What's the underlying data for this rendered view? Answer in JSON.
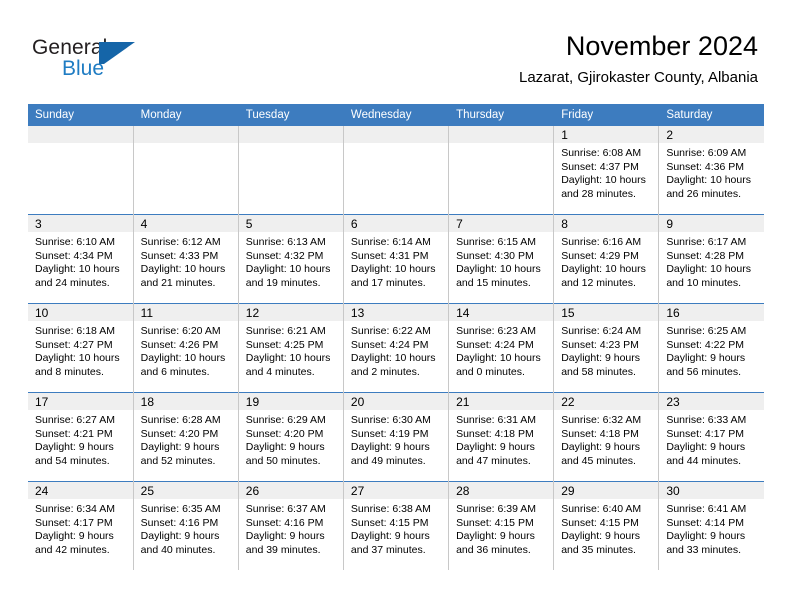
{
  "brand": {
    "name_top": "General",
    "name_bottom": "Blue",
    "mark": "flag-triangle-icon",
    "accent_color": "#1565a8",
    "text_color": "#231f20"
  },
  "header": {
    "title": "November 2024",
    "subtitle": "Lazarat, Gjirokaster County, Albania"
  },
  "theme": {
    "header_blue": "#3d7cbf",
    "daynum_band": "#efefef",
    "grid_line": "#c8c8c8",
    "row_rule": "#3d7cbf"
  },
  "weekday_headers": [
    "Sunday",
    "Monday",
    "Tuesday",
    "Wednesday",
    "Thursday",
    "Friday",
    "Saturday"
  ],
  "weeks": [
    [
      {
        "day": "",
        "empty": true
      },
      {
        "day": "",
        "empty": true
      },
      {
        "day": "",
        "empty": true
      },
      {
        "day": "",
        "empty": true
      },
      {
        "day": "",
        "empty": true
      },
      {
        "day": "1",
        "sunrise": "Sunrise: 6:08 AM",
        "sunset": "Sunset: 4:37 PM",
        "daylight_1": "Daylight: 10 hours",
        "daylight_2": "and 28 minutes."
      },
      {
        "day": "2",
        "sunrise": "Sunrise: 6:09 AM",
        "sunset": "Sunset: 4:36 PM",
        "daylight_1": "Daylight: 10 hours",
        "daylight_2": "and 26 minutes."
      }
    ],
    [
      {
        "day": "3",
        "sunrise": "Sunrise: 6:10 AM",
        "sunset": "Sunset: 4:34 PM",
        "daylight_1": "Daylight: 10 hours",
        "daylight_2": "and 24 minutes."
      },
      {
        "day": "4",
        "sunrise": "Sunrise: 6:12 AM",
        "sunset": "Sunset: 4:33 PM",
        "daylight_1": "Daylight: 10 hours",
        "daylight_2": "and 21 minutes."
      },
      {
        "day": "5",
        "sunrise": "Sunrise: 6:13 AM",
        "sunset": "Sunset: 4:32 PM",
        "daylight_1": "Daylight: 10 hours",
        "daylight_2": "and 19 minutes."
      },
      {
        "day": "6",
        "sunrise": "Sunrise: 6:14 AM",
        "sunset": "Sunset: 4:31 PM",
        "daylight_1": "Daylight: 10 hours",
        "daylight_2": "and 17 minutes."
      },
      {
        "day": "7",
        "sunrise": "Sunrise: 6:15 AM",
        "sunset": "Sunset: 4:30 PM",
        "daylight_1": "Daylight: 10 hours",
        "daylight_2": "and 15 minutes."
      },
      {
        "day": "8",
        "sunrise": "Sunrise: 6:16 AM",
        "sunset": "Sunset: 4:29 PM",
        "daylight_1": "Daylight: 10 hours",
        "daylight_2": "and 12 minutes."
      },
      {
        "day": "9",
        "sunrise": "Sunrise: 6:17 AM",
        "sunset": "Sunset: 4:28 PM",
        "daylight_1": "Daylight: 10 hours",
        "daylight_2": "and 10 minutes."
      }
    ],
    [
      {
        "day": "10",
        "sunrise": "Sunrise: 6:18 AM",
        "sunset": "Sunset: 4:27 PM",
        "daylight_1": "Daylight: 10 hours",
        "daylight_2": "and 8 minutes."
      },
      {
        "day": "11",
        "sunrise": "Sunrise: 6:20 AM",
        "sunset": "Sunset: 4:26 PM",
        "daylight_1": "Daylight: 10 hours",
        "daylight_2": "and 6 minutes."
      },
      {
        "day": "12",
        "sunrise": "Sunrise: 6:21 AM",
        "sunset": "Sunset: 4:25 PM",
        "daylight_1": "Daylight: 10 hours",
        "daylight_2": "and 4 minutes."
      },
      {
        "day": "13",
        "sunrise": "Sunrise: 6:22 AM",
        "sunset": "Sunset: 4:24 PM",
        "daylight_1": "Daylight: 10 hours",
        "daylight_2": "and 2 minutes."
      },
      {
        "day": "14",
        "sunrise": "Sunrise: 6:23 AM",
        "sunset": "Sunset: 4:24 PM",
        "daylight_1": "Daylight: 10 hours",
        "daylight_2": "and 0 minutes."
      },
      {
        "day": "15",
        "sunrise": "Sunrise: 6:24 AM",
        "sunset": "Sunset: 4:23 PM",
        "daylight_1": "Daylight: 9 hours",
        "daylight_2": "and 58 minutes."
      },
      {
        "day": "16",
        "sunrise": "Sunrise: 6:25 AM",
        "sunset": "Sunset: 4:22 PM",
        "daylight_1": "Daylight: 9 hours",
        "daylight_2": "and 56 minutes."
      }
    ],
    [
      {
        "day": "17",
        "sunrise": "Sunrise: 6:27 AM",
        "sunset": "Sunset: 4:21 PM",
        "daylight_1": "Daylight: 9 hours",
        "daylight_2": "and 54 minutes."
      },
      {
        "day": "18",
        "sunrise": "Sunrise: 6:28 AM",
        "sunset": "Sunset: 4:20 PM",
        "daylight_1": "Daylight: 9 hours",
        "daylight_2": "and 52 minutes."
      },
      {
        "day": "19",
        "sunrise": "Sunrise: 6:29 AM",
        "sunset": "Sunset: 4:20 PM",
        "daylight_1": "Daylight: 9 hours",
        "daylight_2": "and 50 minutes."
      },
      {
        "day": "20",
        "sunrise": "Sunrise: 6:30 AM",
        "sunset": "Sunset: 4:19 PM",
        "daylight_1": "Daylight: 9 hours",
        "daylight_2": "and 49 minutes."
      },
      {
        "day": "21",
        "sunrise": "Sunrise: 6:31 AM",
        "sunset": "Sunset: 4:18 PM",
        "daylight_1": "Daylight: 9 hours",
        "daylight_2": "and 47 minutes."
      },
      {
        "day": "22",
        "sunrise": "Sunrise: 6:32 AM",
        "sunset": "Sunset: 4:18 PM",
        "daylight_1": "Daylight: 9 hours",
        "daylight_2": "and 45 minutes."
      },
      {
        "day": "23",
        "sunrise": "Sunrise: 6:33 AM",
        "sunset": "Sunset: 4:17 PM",
        "daylight_1": "Daylight: 9 hours",
        "daylight_2": "and 44 minutes."
      }
    ],
    [
      {
        "day": "24",
        "sunrise": "Sunrise: 6:34 AM",
        "sunset": "Sunset: 4:17 PM",
        "daylight_1": "Daylight: 9 hours",
        "daylight_2": "and 42 minutes."
      },
      {
        "day": "25",
        "sunrise": "Sunrise: 6:35 AM",
        "sunset": "Sunset: 4:16 PM",
        "daylight_1": "Daylight: 9 hours",
        "daylight_2": "and 40 minutes."
      },
      {
        "day": "26",
        "sunrise": "Sunrise: 6:37 AM",
        "sunset": "Sunset: 4:16 PM",
        "daylight_1": "Daylight: 9 hours",
        "daylight_2": "and 39 minutes."
      },
      {
        "day": "27",
        "sunrise": "Sunrise: 6:38 AM",
        "sunset": "Sunset: 4:15 PM",
        "daylight_1": "Daylight: 9 hours",
        "daylight_2": "and 37 minutes."
      },
      {
        "day": "28",
        "sunrise": "Sunrise: 6:39 AM",
        "sunset": "Sunset: 4:15 PM",
        "daylight_1": "Daylight: 9 hours",
        "daylight_2": "and 36 minutes."
      },
      {
        "day": "29",
        "sunrise": "Sunrise: 6:40 AM",
        "sunset": "Sunset: 4:15 PM",
        "daylight_1": "Daylight: 9 hours",
        "daylight_2": "and 35 minutes."
      },
      {
        "day": "30",
        "sunrise": "Sunrise: 6:41 AM",
        "sunset": "Sunset: 4:14 PM",
        "daylight_1": "Daylight: 9 hours",
        "daylight_2": "and 33 minutes."
      }
    ]
  ]
}
